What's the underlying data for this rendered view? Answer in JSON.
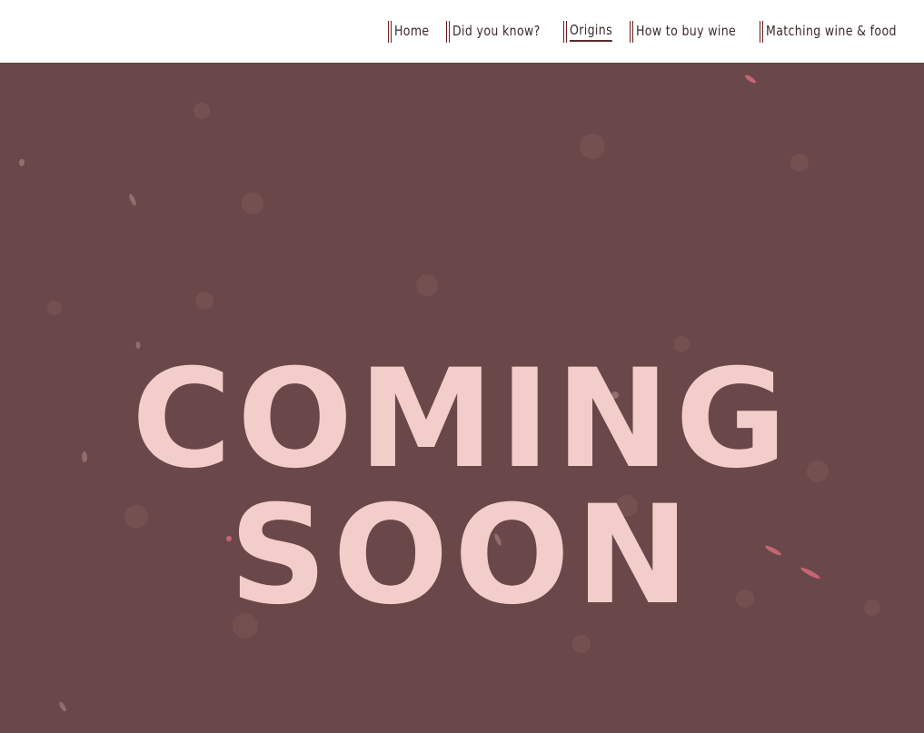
{
  "nav": {
    "items": [
      {
        "label": "Home",
        "active": false
      },
      {
        "label": "Did you know?",
        "active": false
      },
      {
        "label": "Origins",
        "active": true
      },
      {
        "label": "How to buy wine",
        "active": false
      },
      {
        "label": "Matching wine & food",
        "active": false
      }
    ]
  },
  "hero": {
    "title": "COMING SOON",
    "background_color": "#6a4748",
    "title_color": "#f3cdc9"
  },
  "colors": {
    "nav_bar_accent": "#6a1f1f",
    "nav_text": "#3a2a2a"
  }
}
